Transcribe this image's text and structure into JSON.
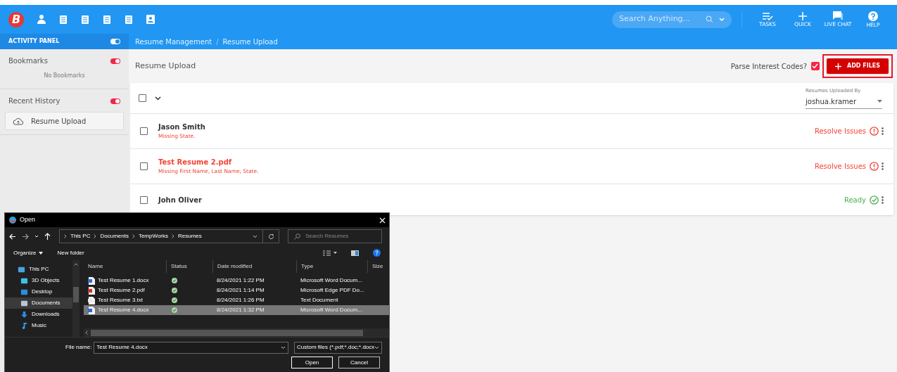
{
  "topbar": {
    "logo": "B",
    "search": {
      "placeholder": "Search Anything..."
    },
    "actions": [
      {
        "kind": "tasks",
        "label": "TASKS"
      },
      {
        "kind": "quick",
        "label": "QUICK"
      },
      {
        "kind": "chat",
        "label": "LIVE CHAT"
      },
      {
        "kind": "help",
        "label": "HELP"
      }
    ]
  },
  "sidebar": {
    "title": "ACTIVITY PANEL",
    "on": true,
    "sections": [
      {
        "title": "Bookmarks",
        "on": true,
        "empty_text": "No Bookmarks"
      },
      {
        "title": "Recent History",
        "on": true,
        "items": [
          "Resume Upload"
        ]
      }
    ]
  },
  "breadcrumb": {
    "separator": "/",
    "items": [
      "Resume Management",
      "Resume Upload"
    ]
  },
  "page": {
    "title": "Resume Upload",
    "parse_label": "Parse Interest Codes?",
    "parse_checked": true,
    "add_button": "ADD FILES",
    "all_checked": false,
    "uploaded_by": {
      "label": "Resumes Uploaded By",
      "value": "joshua.kramer"
    },
    "rows": [
      {
        "kind": "person",
        "name": "Jason Smith",
        "error": true,
        "message": "Missing State.",
        "status": "Resolve Issues",
        "checked": false
      },
      {
        "kind": "file",
        "name": "Test Resume 2.pdf",
        "error": true,
        "message": "Missing First Name, Last Name, State.",
        "status": "Resolve Issues",
        "checked": false
      },
      {
        "kind": "person",
        "name": "John Oliver",
        "error": false,
        "status": "Ready",
        "checked": false
      }
    ]
  },
  "dialog": {
    "title": "Open",
    "path": [
      "This PC",
      "Documents",
      "TempWorks",
      "Resumes"
    ],
    "search_placeholder": "Search Resumes",
    "organize": "Organize",
    "new_folder": "New folder",
    "nav": [
      {
        "label": "This PC",
        "kind": "pc",
        "selected": false
      },
      {
        "label": "3D Objects",
        "kind": "cube",
        "selected": false
      },
      {
        "label": "Desktop",
        "kind": "desktop",
        "selected": false
      },
      {
        "label": "Documents",
        "kind": "docs",
        "selected": true
      },
      {
        "label": "Downloads",
        "kind": "download",
        "selected": false
      },
      {
        "label": "Music",
        "kind": "music",
        "selected": false
      }
    ],
    "columns": [
      "Name",
      "Status",
      "Date modified",
      "Type",
      "Size"
    ],
    "files": [
      {
        "name": "Test Resume 1.docx",
        "kind": "docx",
        "date": "8/24/2021 1:22 PM",
        "type": "Microsoft Word Docum...",
        "selected": false
      },
      {
        "name": "Test Resume 2.pdf",
        "kind": "pdf",
        "date": "8/24/2021 1:14 PM",
        "type": "Microsoft Edge PDF Do...",
        "selected": false
      },
      {
        "name": "Test Resume 3.txt",
        "kind": "txt",
        "date": "8/24/2021 1:26 PM",
        "type": "Text Document",
        "selected": false
      },
      {
        "name": "Test Resume 4.docx",
        "kind": "docx",
        "date": "8/24/2021 1:32 PM",
        "type": "Microsoft Word Docum...",
        "selected": true
      }
    ],
    "file_name_label": "File name:",
    "file_name": "Test Resume 4.docx",
    "filter": "Custom files (*.pdf;*.doc;*.docx",
    "buttons": [
      "Open",
      "Cancel"
    ]
  }
}
